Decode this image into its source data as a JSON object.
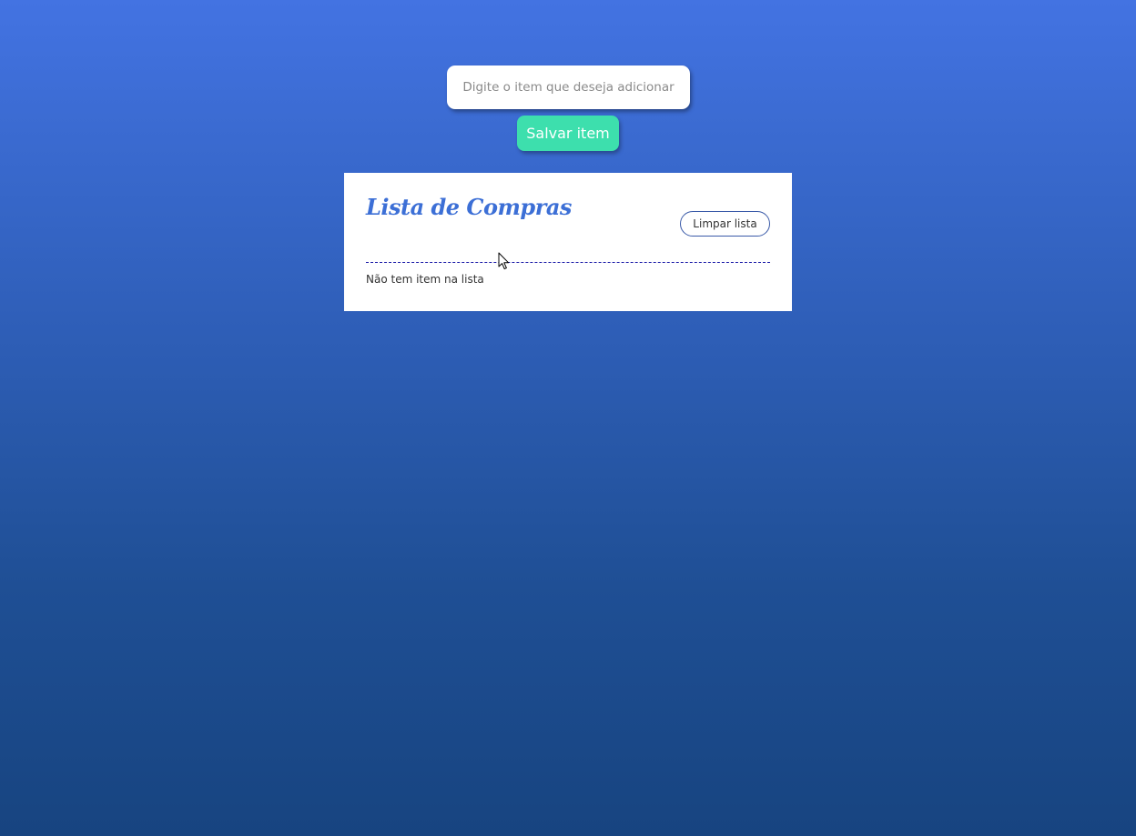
{
  "form": {
    "input_placeholder": "Digite o item que deseja adicionar",
    "input_value": "",
    "save_label": "Salvar item"
  },
  "list": {
    "title": "Lista de Compras",
    "clear_label": "Limpar lista",
    "empty_message": "Não tem item na lista",
    "items": []
  },
  "colors": {
    "background_top": "#4373e2",
    "background_bottom": "#174480",
    "save_button": "#3ddfad",
    "title": "#3c6fd6",
    "divider": "#1a1aa8"
  },
  "icons": {
    "pointer": "mouse-pointer-icon"
  }
}
